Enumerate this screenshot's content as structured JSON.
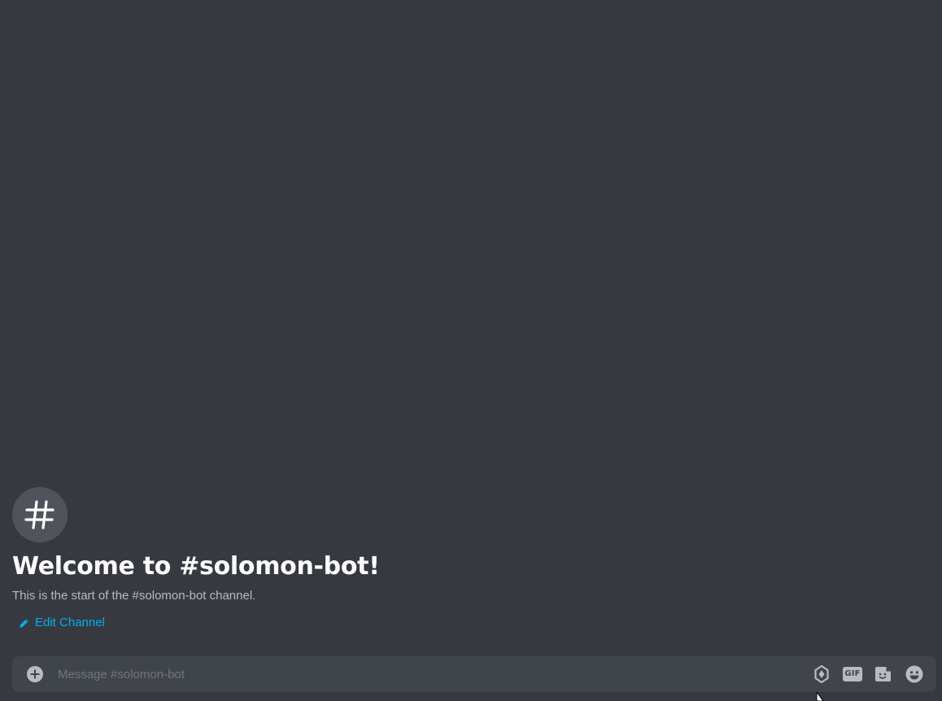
{
  "channel": {
    "icon": "hashtag-icon",
    "welcome_title": "Welcome to #solomon-bot!",
    "welcome_description": "This is the start of the #solomon-bot channel.",
    "edit_label": "Edit Channel",
    "edit_icon": "pencil-icon"
  },
  "composer": {
    "placeholder": "Message #solomon-bot",
    "value": "",
    "attach_icon": "plus-circle-icon",
    "buttons": [
      {
        "icon": "nitro-gift-icon"
      },
      {
        "label": "GIF",
        "icon": "gif-icon"
      },
      {
        "icon": "sticker-icon"
      },
      {
        "icon": "emoji-icon"
      }
    ]
  },
  "colors": {
    "background": "#36393f",
    "composer_bg": "#40444b",
    "icon_circle": "#4f545c",
    "link": "#00b0f4",
    "title": "#ffffff",
    "muted": "#b9bbbe",
    "placeholder": "#72767d"
  }
}
